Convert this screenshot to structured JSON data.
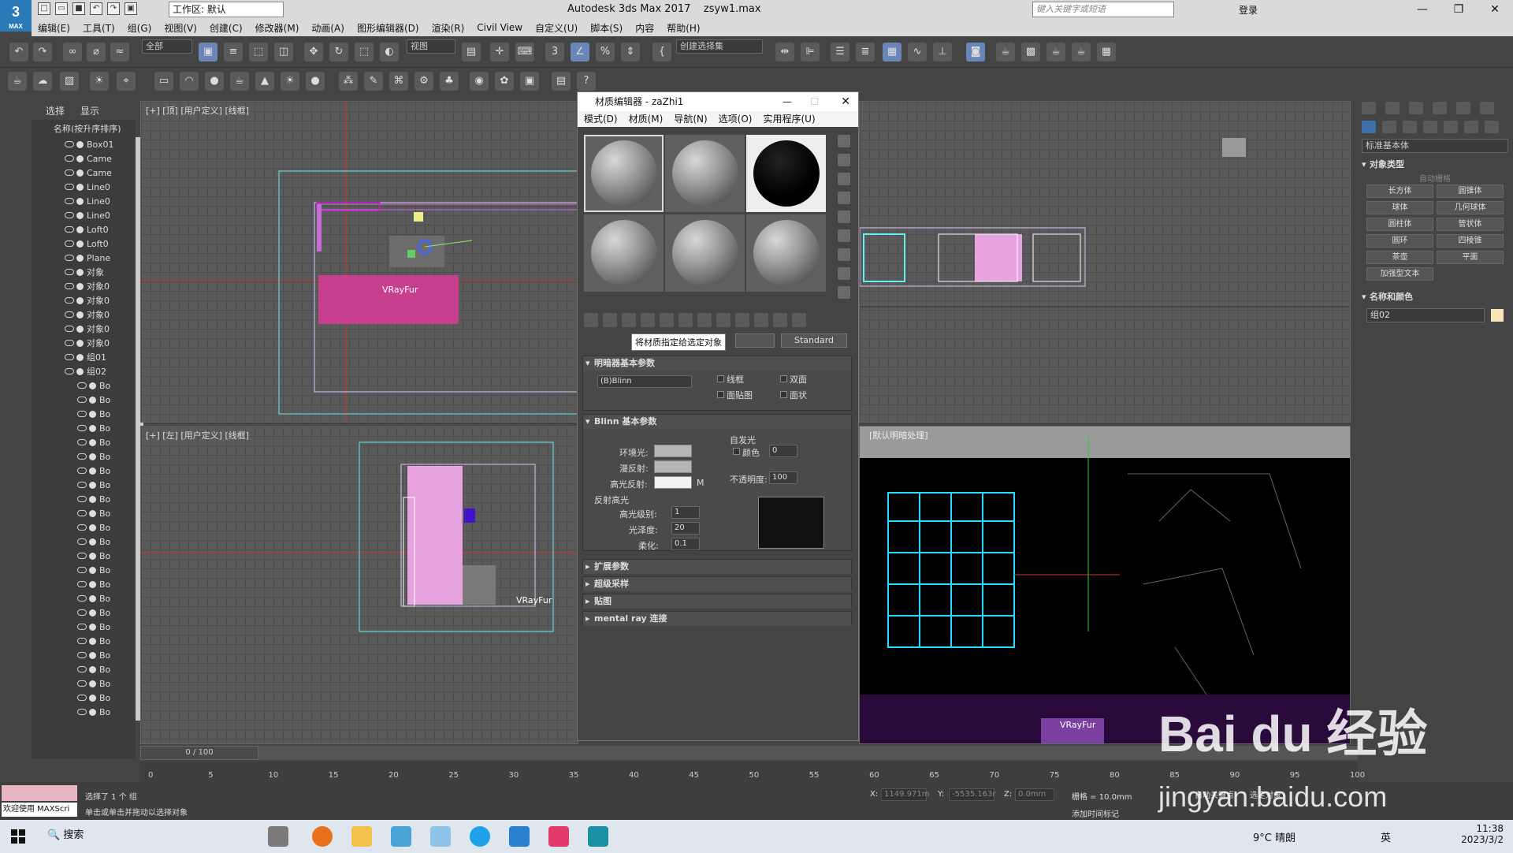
{
  "app": {
    "title": "Autodesk 3ds Max 2017",
    "file": "zsyw1.max",
    "logo_text": "3",
    "logo_sub": "MAX",
    "workspace": "工作区: 默认",
    "search_placeholder": "键入关键字或短语",
    "login": "登录"
  },
  "menu": [
    "编辑(E)",
    "工具(T)",
    "组(G)",
    "视图(V)",
    "创建(C)",
    "修改器(M)",
    "动画(A)",
    "图形编辑器(D)",
    "渲染(R)",
    "Civil View",
    "自定义(U)",
    "脚本(S)",
    "内容",
    "帮助(H)"
  ],
  "toolbar": {
    "select_filter": "全部",
    "ref_coord": "视图",
    "named_sel": "创建选择集"
  },
  "scene_explorer": {
    "tabs": [
      "选择",
      "显示"
    ],
    "header": "名称(按升序排序)",
    "items": [
      "Box01",
      "Came",
      "Came",
      "Line0",
      "Line0",
      "Line0",
      "Loft0",
      "Loft0",
      "Plane",
      "对象",
      "对象0",
      "对象0",
      "对象0",
      "对象0",
      "对象0",
      "组01",
      "组02",
      "Bo",
      "Bo",
      "Bo",
      "Bo",
      "Bo",
      "Bo",
      "Bo",
      "Bo",
      "Bo",
      "Bo",
      "Bo",
      "Bo",
      "Bo",
      "Bo",
      "Bo",
      "Bo",
      "Bo",
      "Bo",
      "Bo",
      "Bo",
      "Bo",
      "Bo",
      "Bo",
      "Bo"
    ]
  },
  "viewports": {
    "top": "[+] [顶] [用户定义] [线框]",
    "left": "[+] [左] [用户定义] [线框]",
    "persp": "[默认明暗处理]",
    "vrayfur": "VRayFur"
  },
  "material_editor": {
    "title": "材质编辑器 - zaZhi1",
    "menu": [
      "模式(D)",
      "材质(M)",
      "导航(N)",
      "选项(O)",
      "实用程序(U)"
    ],
    "tooltip": "将材质指定给选定对象",
    "type_button": "Standard",
    "shader_rollout": "明暗器基本参数",
    "shader_value": "(B)Blinn",
    "checks": [
      "线框",
      "双面",
      "面贴图",
      "面状"
    ],
    "blinn_rollout": "Blinn 基本参数",
    "self_illum": "自发光",
    "color_label": "颜色",
    "color_value": "0",
    "ambient": "环境光:",
    "diffuse": "漫反射:",
    "specular": "高光反射:",
    "specular_m": "M",
    "opacity_label": "不透明度:",
    "opacity_value": "100",
    "spec_highlights": "反射高光",
    "spec_level_label": "高光级别:",
    "spec_level": "1",
    "gloss_label": "光泽度:",
    "gloss": "20",
    "soften_label": "柔化:",
    "soften": "0.1",
    "rollouts": [
      "扩展参数",
      "超级采样",
      "贴图",
      "mental ray 连接"
    ]
  },
  "command_panel": {
    "dropdown": "标准基本体",
    "object_type": "对象类型",
    "autogrid": "自动栅格",
    "buttons": [
      "长方体",
      "圆锥体",
      "球体",
      "几何球体",
      "圆柱体",
      "管状体",
      "圆环",
      "四棱锥",
      "茶壶",
      "平面",
      "加强型文本"
    ],
    "name_color": "名称和颜色",
    "name_value": "组02"
  },
  "timeline": {
    "frame": "0 / 100",
    "ticks": [
      "0",
      "5",
      "10",
      "15",
      "20",
      "25",
      "30",
      "35",
      "40",
      "45",
      "50",
      "55",
      "60",
      "65",
      "70",
      "75",
      "80",
      "85",
      "90",
      "95",
      "100"
    ]
  },
  "status": {
    "welcome": "欢迎使用 MAXScri",
    "selected": "选择了 1 个 组",
    "prompt": "单击或单击并拖动以选择对象",
    "x_label": "X:",
    "x": "1149.971m",
    "y_label": "Y:",
    "y": "-5535.163r",
    "z_label": "Z:",
    "z": "0.0mm",
    "grid": "栅格 = 10.0mm",
    "add_time_tag": "添加时间标记",
    "autokey": "自动关键点",
    "selected_obj": "选定对象"
  },
  "taskbar": {
    "search": "搜索",
    "weather": "9°C 晴朗",
    "lang": "英",
    "time": "11:38",
    "date": "2023/3/2"
  },
  "watermark": {
    "line1": "Bai du 经验",
    "line2": "jingyan.baidu.com"
  }
}
